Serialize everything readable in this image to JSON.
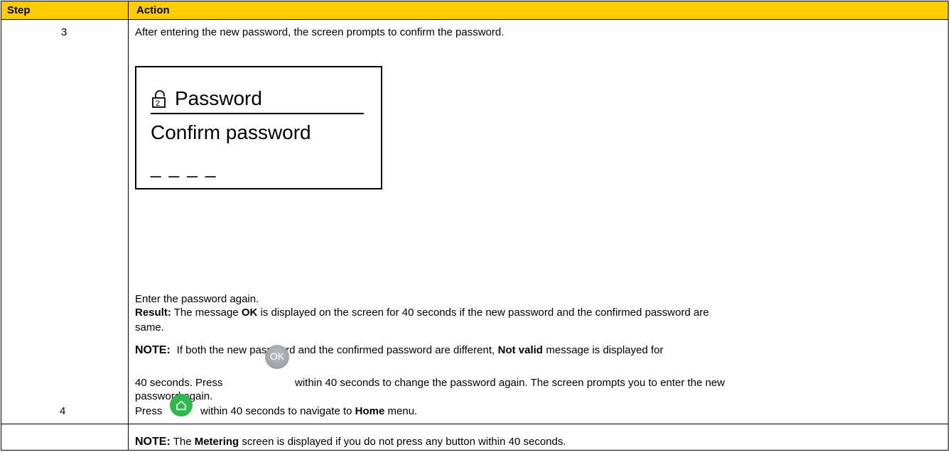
{
  "table": {
    "headers": {
      "step": "Step",
      "action": "Action"
    },
    "rows": [
      {
        "step": "3",
        "intro": "After entering the new password, the screen prompts to confirm the password.",
        "device_screen": {
          "title": "Password",
          "subtitle": "Confirm password",
          "entry": "_ _ _ _",
          "icon": "lock-icon"
        },
        "instruction": "Enter the password again.",
        "result_label": "Result:",
        "result_pre": "The message",
        "result_ok": "OK",
        "result_post_line1": "is displayed on the screen for 40 seconds if the new password and the confirmed password are",
        "result_post_line2": "same.",
        "note_label": "NOTE:",
        "note_pre": "If both the new password and the confirmed password are different,",
        "note_bold": "Not valid",
        "note_post": "message is displayed for",
        "note_line2_pre": "40 seconds. Press",
        "ok_button_label": "OK",
        "note_line2_post": "within 40 seconds to change the password again. The screen prompts you to enter the new",
        "note_line3": "password again."
      },
      {
        "step": "4",
        "press_pre": "Press",
        "home_icon": "home-icon",
        "press_post": "within 40 seconds to navigate to",
        "home_bold": "Home",
        "press_tail": "menu.",
        "note_label": "NOTE:",
        "note_pre": "The",
        "note_bold": "Metering",
        "note_post": "screen is displayed if you do not press any button within 40 seconds."
      }
    ]
  },
  "colors": {
    "header_bg": "#ffcc00",
    "home_button": "#2fb84c",
    "ok_button": "#9aa0a5"
  }
}
